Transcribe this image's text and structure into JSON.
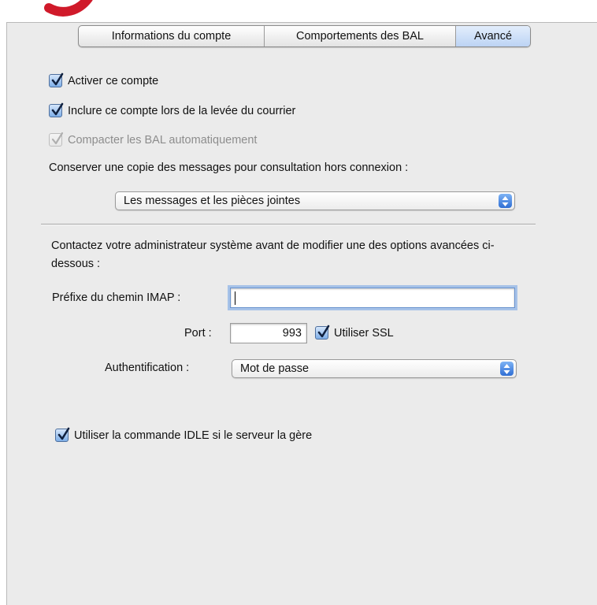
{
  "tabs": [
    {
      "label": "Informations du compte",
      "selected": false
    },
    {
      "label": "Comportements des BAL",
      "selected": false
    },
    {
      "label": "Avancé",
      "selected": true
    }
  ],
  "options": {
    "activate_account": {
      "label": "Activer ce compte",
      "checked": true
    },
    "include_in_check": {
      "label": "Inclure ce compte lors de la levée du courrier",
      "checked": true
    },
    "compact_mailboxes": {
      "label": "Compacter les BAL automatiquement",
      "checked": true,
      "enabled": false
    }
  },
  "offline": {
    "label": "Conserver une copie des messages pour consultation hors connexion :",
    "selected": "Les messages et les pièces jointes"
  },
  "advanced": {
    "notice": "Contactez votre administrateur système avant de modifier une des options avancées ci-dessous :",
    "imap_prefix_label": "Préfixe du chemin IMAP :",
    "imap_prefix_value": "",
    "port_label": "Port :",
    "port_value": "993",
    "ssl_label": "Utiliser SSL",
    "ssl_checked": true,
    "auth_label": "Authentification :",
    "auth_value": "Mot de passe"
  },
  "idle": {
    "label": "Utiliser la commande IDLE si le serveur la gère",
    "checked": true
  },
  "colors": {
    "panel": "#ebebeb",
    "accent": "#2f6ed4",
    "annotation": "#d01a2a"
  }
}
